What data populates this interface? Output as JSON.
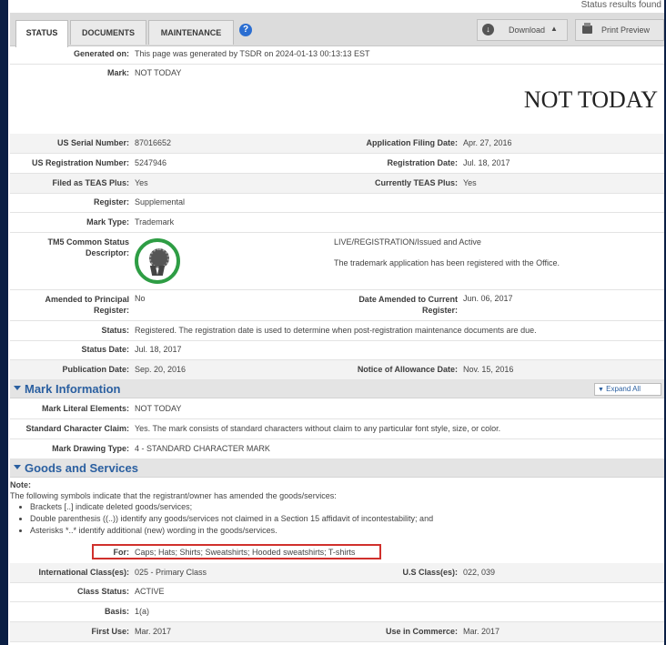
{
  "top_status": "Status results found",
  "tabs": [
    "STATUS",
    "DOCUMENTS",
    "MAINTENANCE"
  ],
  "toolbar": {
    "download": "Download",
    "print": "Print Preview"
  },
  "icons": {
    "help": "help-icon",
    "download": "download-icon",
    "print": "printer-icon",
    "status_seal": "registered-seal-icon"
  },
  "colors": {
    "seal_green": "#2e9d44",
    "section_title": "#2a5fa0",
    "highlight_box": "#d0302c"
  },
  "status": {
    "generated_label": "Generated on:",
    "generated_value": "This page was generated by TSDR on 2024-01-13 00:13:13 EST",
    "mark_label": "Mark:",
    "mark_value": "NOT TODAY",
    "mark_display": "NOT TODAY",
    "serial_label": "US Serial Number:",
    "serial_value": "87016652",
    "filing_label": "Application Filing Date:",
    "filing_value": "Apr. 27, 2016",
    "reg_num_label": "US Registration Number:",
    "reg_num_value": "5247946",
    "reg_date_label": "Registration Date:",
    "reg_date_value": "Jul. 18, 2017",
    "teas_label": "Filed as TEAS Plus:",
    "teas_value": "Yes",
    "cur_teas_label": "Currently TEAS Plus:",
    "cur_teas_value": "Yes",
    "register_label": "Register:",
    "register_value": "Supplemental",
    "mark_type_label": "Mark Type:",
    "mark_type_value": "Trademark",
    "tm5_label": "TM5 Common Status Descriptor:",
    "tm5_status": "LIVE/REGISTRATION/Issued and Active",
    "tm5_desc": "The trademark application has been registered with the Office.",
    "amended_label": "Amended to Principal Register:",
    "amended_value": "No",
    "date_amended_label": "Date Amended to Current Register:",
    "date_amended_value": "Jun. 06, 2017",
    "status_label": "Status:",
    "status_value": "Registered. The registration date is used to determine when post-registration maintenance documents are due.",
    "status_date_label": "Status Date:",
    "status_date_value": "Jul. 18, 2017",
    "pub_date_label": "Publication Date:",
    "pub_date_value": "Sep. 20, 2016",
    "allowance_label": "Notice of Allowance Date:",
    "allowance_value": "Nov. 15, 2016"
  },
  "mark_info": {
    "title": "Mark Information",
    "expand_all": "Expand All",
    "literal_label": "Mark Literal Elements:",
    "literal_value": "NOT TODAY",
    "std_char_label": "Standard Character Claim:",
    "std_char_value": "Yes. The mark consists of standard characters without claim to any particular font style, size, or color.",
    "drawing_label": "Mark Drawing Type:",
    "drawing_value": "4 - STANDARD CHARACTER MARK"
  },
  "goods": {
    "title": "Goods and Services",
    "note_label": "Note:",
    "note_intro": "The following symbols indicate that the registrant/owner has amended the goods/services:",
    "note_items": [
      "Brackets [..] indicate deleted goods/services;",
      "Double parenthesis ((..)) identify any goods/services not claimed in a Section 15 affidavit of incontestability; and",
      "Asterisks *..* identify additional (new) wording in the goods/services."
    ],
    "for_label": "For:",
    "for_value": "Caps; Hats; Shirts; Sweatshirts; Hooded sweatshirts; T-shirts",
    "intl_label": "International Class(es):",
    "intl_value": "025 - Primary Class",
    "us_label": "U.S Class(es):",
    "us_value": "022, 039",
    "class_status_label": "Class Status:",
    "class_status_value": "ACTIVE",
    "basis_label": "Basis:",
    "basis_value": "1(a)",
    "first_use_label": "First Use:",
    "first_use_value": "Mar. 2017",
    "commerce_label": "Use in Commerce:",
    "commerce_value": "Mar. 2017"
  }
}
